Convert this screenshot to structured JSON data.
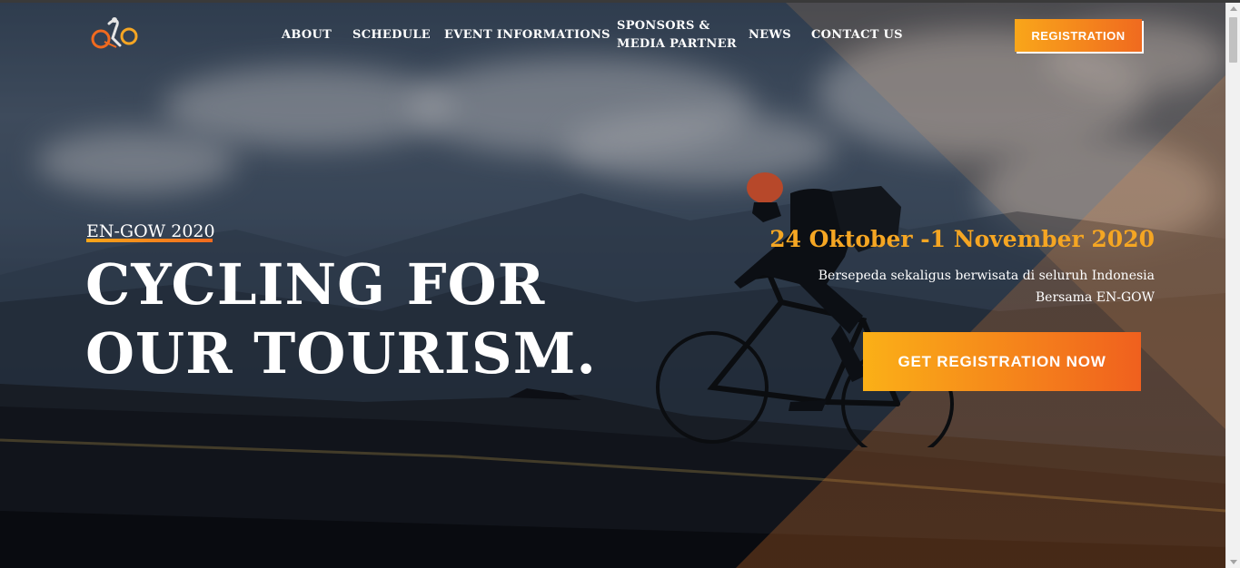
{
  "header": {
    "logo_alt": "EN-GOW logo",
    "nav": [
      {
        "label": "ABOUT"
      },
      {
        "label": "SCHEDULE"
      },
      {
        "label": "EVENT INFORMATIONS"
      },
      {
        "label": "SPONSORS &",
        "label2": "MEDIA PARTNER"
      },
      {
        "label": "NEWS"
      },
      {
        "label": "CONTACT US"
      }
    ],
    "registration_label": "REGISTRATION"
  },
  "hero": {
    "eyebrow": "EN-GOW 2020",
    "headline_line1": "CYCLING FOR",
    "headline_line2": "OUR TOURISM.",
    "date": "24 Oktober -1 November 2020",
    "description_line1": "Bersepeda sekaligus berwisata di seluruh Indonesia",
    "description_line2": "Bersama EN-GOW",
    "cta_label": "GET REGISTRATION NOW"
  },
  "colors": {
    "accent_start": "#f9a61a",
    "accent_end": "#f06a1f",
    "date_color": "#f5a623"
  }
}
